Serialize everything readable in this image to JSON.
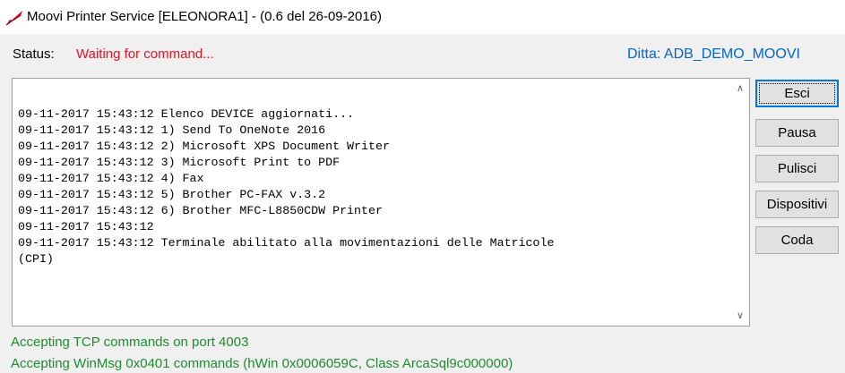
{
  "window": {
    "title": "Moovi Printer Service [ELEONORA1] - (0.6 del 26-09-2016)",
    "icon": "red-feather-icon"
  },
  "status": {
    "label": "Status:",
    "value": "Waiting for command...",
    "value_color": "#e81123"
  },
  "ditta": {
    "text": "Ditta: ADB_DEMO_MOOVI",
    "color": "#0066cc"
  },
  "log": {
    "lines": [
      "09-11-2017 15:43:12 Elenco DEVICE aggiornati...",
      "09-11-2017 15:43:12 1) Send To OneNote 2016",
      "09-11-2017 15:43:12 2) Microsoft XPS Document Writer",
      "09-11-2017 15:43:12 3) Microsoft Print to PDF",
      "09-11-2017 15:43:12 4) Fax",
      "09-11-2017 15:43:12 5) Brother PC-FAX v.3.2",
      "09-11-2017 15:43:12 6) Brother MFC-L8850CDW Printer",
      "09-11-2017 15:43:12",
      "09-11-2017 15:43:12 Terminale abilitato alla movimentazioni delle Matricole",
      "(CPI)"
    ]
  },
  "buttons": {
    "esci": "Esci",
    "pausa": "Pausa",
    "pulisci": "Pulisci",
    "dispositivi": "Dispositivi",
    "coda": "Coda"
  },
  "footer": {
    "line1": "Accepting TCP commands on port 4003",
    "line2": "Accepting WinMsg 0x0401 commands (hWin 0x0006059C, Class ArcaSql9c000000)",
    "color": "#1e8c2e"
  }
}
